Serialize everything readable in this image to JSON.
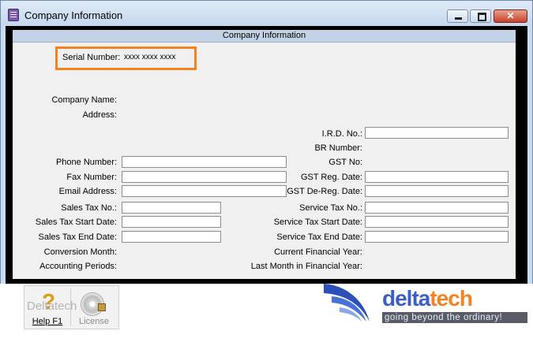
{
  "window": {
    "title": "Company Information"
  },
  "panel": {
    "header": "Company Information"
  },
  "serial": {
    "label": "Serial Number:",
    "value": "xxxx xxxx xxxx"
  },
  "fields_left": [
    {
      "label": "Company Name:"
    },
    {
      "label": "Address:"
    },
    {
      "label": "Phone Number:"
    },
    {
      "label": "Fax Number:"
    },
    {
      "label": "Email Address:"
    },
    {
      "label": "Sales Tax No.:"
    },
    {
      "label": "Sales Tax Start Date:"
    },
    {
      "label": "Sales Tax End Date:"
    },
    {
      "label": "Conversion Month:"
    },
    {
      "label": "Accounting Periods:"
    }
  ],
  "fields_right": [
    {
      "label": "I.R.D. No.:"
    },
    {
      "label": "BR Number:"
    },
    {
      "label": "GST No:"
    },
    {
      "label": "GST Reg. Date:"
    },
    {
      "label": "GST De-Reg. Date:"
    },
    {
      "label": "Service Tax No.:"
    },
    {
      "label": "Service Tax Start Date:"
    },
    {
      "label": "Service Tax End Date:"
    },
    {
      "label": "Current Financial Year:"
    },
    {
      "label": "Last Month in Financial Year:"
    }
  ],
  "toolbar": {
    "help_label": "Help F1",
    "license_label": "License"
  },
  "branding": {
    "watermark": "Deltatech",
    "brand_first": "delta",
    "brand_second": "tech",
    "tagline": "going beyond the ordinary!"
  },
  "colors": {
    "highlight": "#f48220",
    "brand_blue": "#3a5ec6",
    "brand_orange": "#f48220"
  },
  "icons": [
    "app-icon",
    "minimize-icon",
    "maximize-icon",
    "close-icon",
    "help-icon",
    "license-icon"
  ]
}
